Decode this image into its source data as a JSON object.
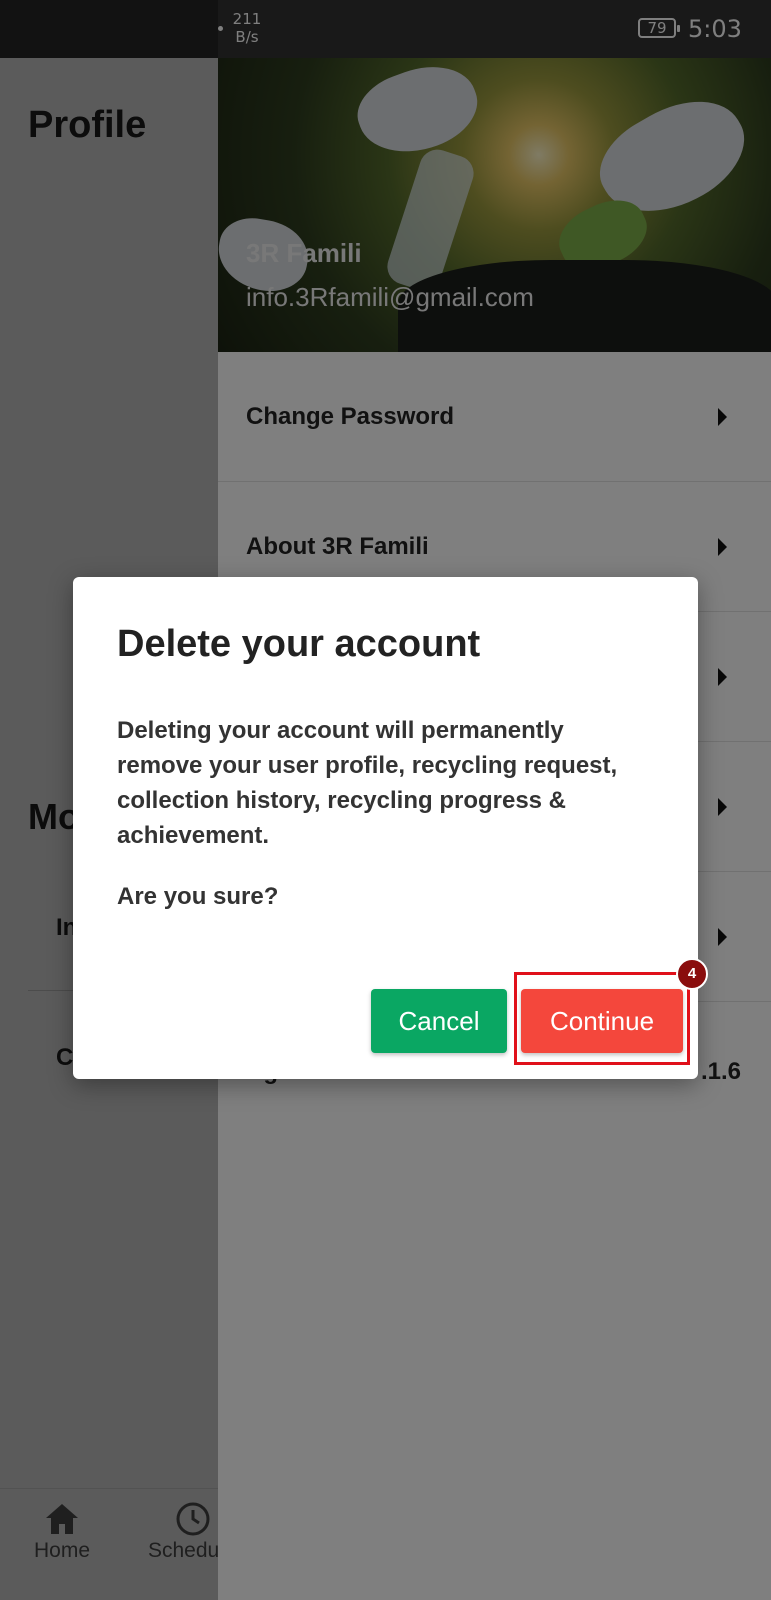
{
  "status_bar": {
    "net_speed_value": "211",
    "net_speed_unit": "B/s",
    "battery": "79",
    "time": "5:03"
  },
  "background_screen": {
    "title": "Profile",
    "section_partial": "Mo",
    "item1_partial": "In",
    "item2_partial": "C",
    "bottom_nav": {
      "home_label": "Home",
      "schedule_label": "Schedu",
      "home_icon": "home-icon",
      "schedule_icon": "clock-icon"
    }
  },
  "drawer": {
    "user_name": "3R Famili",
    "user_email": "info.3Rfamili@gmail.com",
    "menu_items": [
      {
        "label": "Change Password"
      },
      {
        "label": "About 3R Famili"
      },
      {
        "label": ""
      },
      {
        "label": ""
      },
      {
        "label": ""
      }
    ],
    "version_label_partial": "Ag",
    "version_value": ".1.6"
  },
  "dialog": {
    "title": "Delete your account",
    "body": "Deleting your account will permanently remove your user profile, recycling request, collection history, recycling progress & achievement.",
    "question": "Are you sure?",
    "cancel_label": "Cancel",
    "continue_label": "Continue"
  },
  "annotation": {
    "badge_number": "4",
    "highlight_color": "#e0101a"
  },
  "colors": {
    "cancel_button": "#0aa763",
    "continue_button": "#f4473c",
    "badge": "#8a0d0d"
  }
}
